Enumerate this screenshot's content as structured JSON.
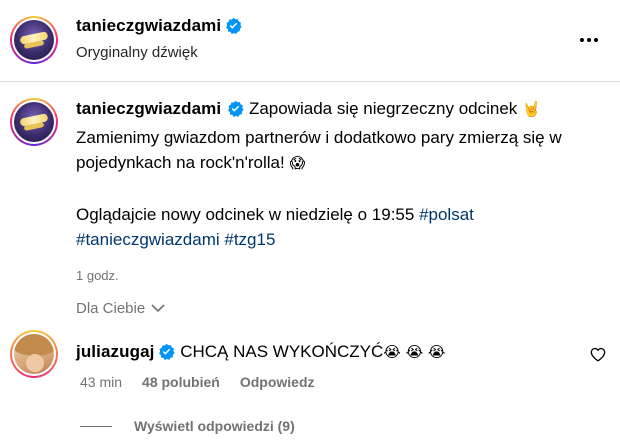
{
  "post_header": {
    "username": "tanieczgwiazdami",
    "audio_label": "Oryginalny dźwięk"
  },
  "caption": {
    "username": "tanieczgwiazdami",
    "line1": "Zapowiada się niegrzeczny odcinek",
    "emoji_horns": "🤘",
    "line2": "Zamienimy gwiazdom partnerów i dodatkowo pary zmierzą się w",
    "line3": "pojedynkach na rock'n'rolla!",
    "emoji_scream": "😱",
    "line4": "Oglądajcie nowy odcinek w niedzielę o 19:55",
    "hashtag_polsat": "#polsat",
    "hashtag_taniec": "#tanieczgwiazdami",
    "hashtag_tzg": "#tzg15",
    "time": "1 godz."
  },
  "filter": {
    "label": "Dla Ciebie"
  },
  "comment": {
    "username": "juliazugaj",
    "text": "CHCĄ NAS WYKOŃCZYĆ",
    "emojis": "😭 😭 😭",
    "time": "43 min",
    "likes": "48 polubień",
    "reply_label": "Odpowiedz",
    "view_replies": "Wyświetl odpowiedzi (9)"
  },
  "colors": {
    "verified": "#0095f6",
    "hashtag": "#00376b",
    "muted": "#737373"
  }
}
